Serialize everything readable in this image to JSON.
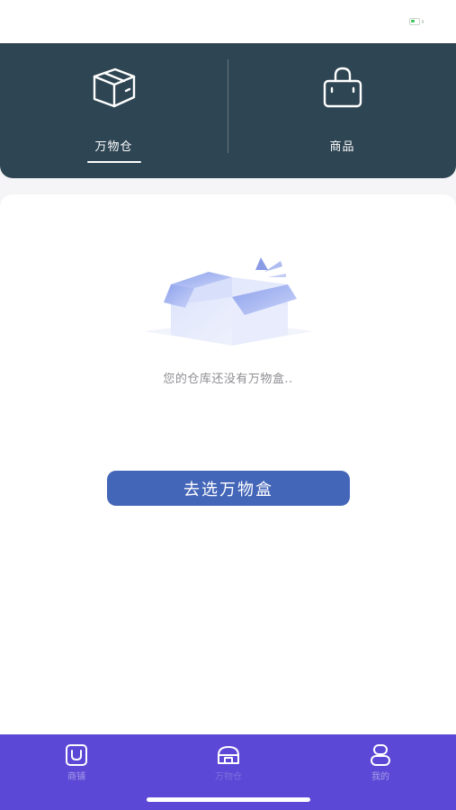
{
  "status_bar": {
    "battery_level": 0.55,
    "battery_color": "#43c35e"
  },
  "header": {
    "background": "#2e4553",
    "tabs": [
      {
        "label": "万物仓",
        "icon": "box-icon",
        "active": true
      },
      {
        "label": "商品",
        "icon": "shopping-bag-icon",
        "active": false
      }
    ]
  },
  "main": {
    "empty_illustration": "open-box-illustration",
    "empty_text": "您的仓库还没有万物盒..",
    "select_button_label": "去选万物盒",
    "button_color": "#4466b8"
  },
  "bottom_nav": {
    "background": "#5b48d6",
    "items": [
      {
        "label": "商铺",
        "icon": "shop-icon",
        "active": false
      },
      {
        "label": "万物仓",
        "icon": "warehouse-icon",
        "active": true
      },
      {
        "label": "我的",
        "icon": "profile-icon",
        "active": false
      }
    ]
  }
}
